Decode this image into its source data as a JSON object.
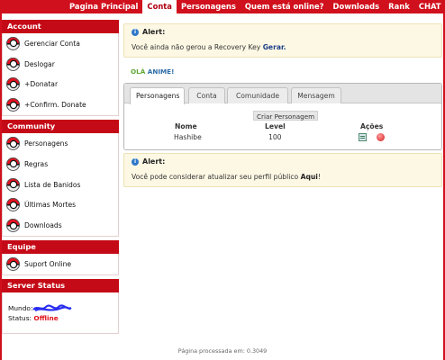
{
  "topnav": [
    "Pagina Principal",
    "Conta",
    "Personagens",
    "Quem está online?",
    "Downloads",
    "Rank",
    "CHAT"
  ],
  "sidebar": {
    "account": {
      "title": "Account",
      "items": [
        "Gerenciar Conta",
        "Deslogar",
        "+Donatar",
        "+Confirm. Donate"
      ]
    },
    "community": {
      "title": "Community",
      "items": [
        "Personagens",
        "Regras",
        "Lista de Banidos",
        "Últimas Mortes",
        "Downloads"
      ]
    },
    "team": {
      "title": "Equipe",
      "items": [
        "Suport Online"
      ]
    },
    "server_status": {
      "title": "Server Status",
      "world_label": "Mundo:",
      "status_label": "Status:",
      "status_value": "Offline"
    }
  },
  "alert1": {
    "title": "Alert:",
    "text": "Você ainda não gerou a Recovery Key ",
    "link": "Gerar."
  },
  "greeting": {
    "prefix": "OLÁ ",
    "name": "ANIME!"
  },
  "tabs": [
    "Personagens",
    "Conta",
    "Comunidade",
    "Mensagem"
  ],
  "characters": {
    "create_label": "Criar Personagem",
    "headers": {
      "name": "Nome",
      "level": "Level",
      "actions": "Ações"
    },
    "rows": [
      {
        "name": "Hashibe",
        "level": "100"
      }
    ],
    "icons": [
      "edit-icon",
      "delete-icon"
    ]
  },
  "alert2": {
    "title": "Alert:",
    "text": "Você pode considerar atualizar seu perfil público ",
    "link": "Aqui",
    "suffix": "!"
  },
  "footer": "Página processada em: 0.3049",
  "colors": {
    "brand_red": "#d0101c",
    "alert_bg": "#fdf8e4",
    "offline": "#e0101a",
    "greeting": "#5fa832"
  }
}
